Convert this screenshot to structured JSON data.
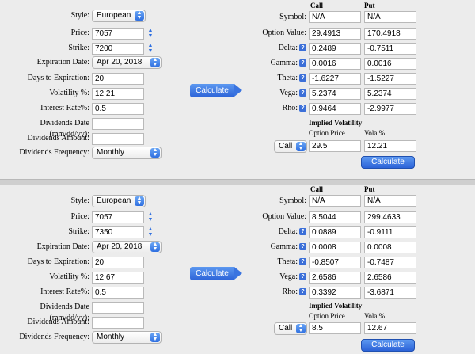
{
  "panels": [
    {
      "inputs": {
        "style_label": "Style:",
        "style_value": "European",
        "price_label": "Price:",
        "price_value": "7057",
        "strike_label": "Strike:",
        "strike_value": "7200",
        "expiration_label": "Expiration Date:",
        "expiration_value": "Apr 20, 2018",
        "days_label": "Days to Expiration:",
        "days_value": "20",
        "volatility_label": "Volatility %:",
        "volatility_value": "12.21",
        "interest_label": "Interest Rate%:",
        "interest_value": "0.5",
        "div_date_label": "Dividends Date (mm/dd/yy):",
        "div_date_value": "",
        "div_amount_label": "Dividends Amount:",
        "div_amount_value": "",
        "div_freq_label": "Dividends Frequency:",
        "div_freq_value": "Monthly"
      },
      "calculate_label": "Calculate",
      "results": {
        "call_header": "Call",
        "put_header": "Put",
        "symbol_label": "Symbol:",
        "symbol_call": "N/A",
        "symbol_put": "N/A",
        "option_value_label": "Option Value:",
        "option_value_call": "29.4913",
        "option_value_put": "170.4918",
        "delta_label": "Delta:",
        "delta_call": "0.2489",
        "delta_put": "-0.7511",
        "gamma_label": "Gamma:",
        "gamma_call": "0.0016",
        "gamma_put": "0.0016",
        "theta_label": "Theta:",
        "theta_call": "-1.6227",
        "theta_put": "-1.5227",
        "vega_label": "Vega:",
        "vega_call": "5.2374",
        "vega_put": "5.2374",
        "rho_label": "Rho:",
        "rho_call": "0.9464",
        "rho_put": "-2.9977"
      },
      "implied": {
        "title": "Implied Volatility",
        "option_price_header": "Option Price",
        "vola_header": "Vola %",
        "type_value": "Call",
        "option_price_value": "29.5",
        "vola_value": "12.21",
        "calculate_label": "Calculate"
      }
    },
    {
      "inputs": {
        "style_label": "Style:",
        "style_value": "European",
        "price_label": "Price:",
        "price_value": "7057",
        "strike_label": "Strike:",
        "strike_value": "7350",
        "expiration_label": "Expiration Date:",
        "expiration_value": "Apr 20, 2018",
        "days_label": "Days to Expiration:",
        "days_value": "20",
        "volatility_label": "Volatility %:",
        "volatility_value": "12.67",
        "interest_label": "Interest Rate%:",
        "interest_value": "0.5",
        "div_date_label": "Dividends Date (mm/dd/yy):",
        "div_date_value": "",
        "div_amount_label": "Dividends Amount:",
        "div_amount_value": "",
        "div_freq_label": "Dividends Frequency:",
        "div_freq_value": "Monthly"
      },
      "calculate_label": "Calculate",
      "results": {
        "call_header": "Call",
        "put_header": "Put",
        "symbol_label": "Symbol:",
        "symbol_call": "N/A",
        "symbol_put": "N/A",
        "option_value_label": "Option Value:",
        "option_value_call": "8.5044",
        "option_value_put": "299.4633",
        "delta_label": "Delta:",
        "delta_call": "0.0889",
        "delta_put": "-0.9111",
        "gamma_label": "Gamma:",
        "gamma_call": "0.0008",
        "gamma_put": "0.0008",
        "theta_label": "Theta:",
        "theta_call": "-0.8507",
        "theta_put": "-0.7487",
        "vega_label": "Vega:",
        "vega_call": "2.6586",
        "vega_put": "2.6586",
        "rho_label": "Rho:",
        "rho_call": "0.3392",
        "rho_put": "-3.6871"
      },
      "implied": {
        "title": "Implied Volatility",
        "option_price_header": "Option Price",
        "vola_header": "Vola %",
        "type_value": "Call",
        "option_price_value": "8.5",
        "vola_value": "12.67",
        "calculate_label": "Calculate"
      }
    }
  ],
  "icons": {
    "select_arrow": "chevron-up-down-icon",
    "stepper": "stepper-icon",
    "help": "question-mark-icon"
  },
  "colors": {
    "accent": "#2c63d8",
    "background": "#ececec",
    "separator": "#cfcfcf"
  }
}
